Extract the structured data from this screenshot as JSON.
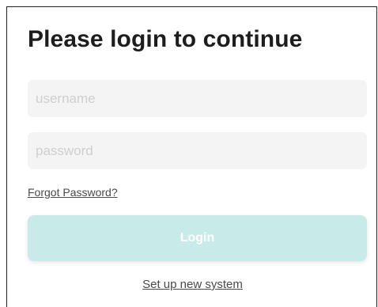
{
  "login": {
    "title": "Please login to continue",
    "username_placeholder": "username",
    "password_placeholder": "password",
    "username_value": "",
    "password_value": "",
    "forgot_label": "Forgot Password?",
    "login_label": "Login",
    "setup_label": "Set up new system"
  },
  "colors": {
    "login_button_bg": "#c8ebea",
    "input_bg": "#f4f4f4",
    "title_text": "#1d1d1d"
  }
}
